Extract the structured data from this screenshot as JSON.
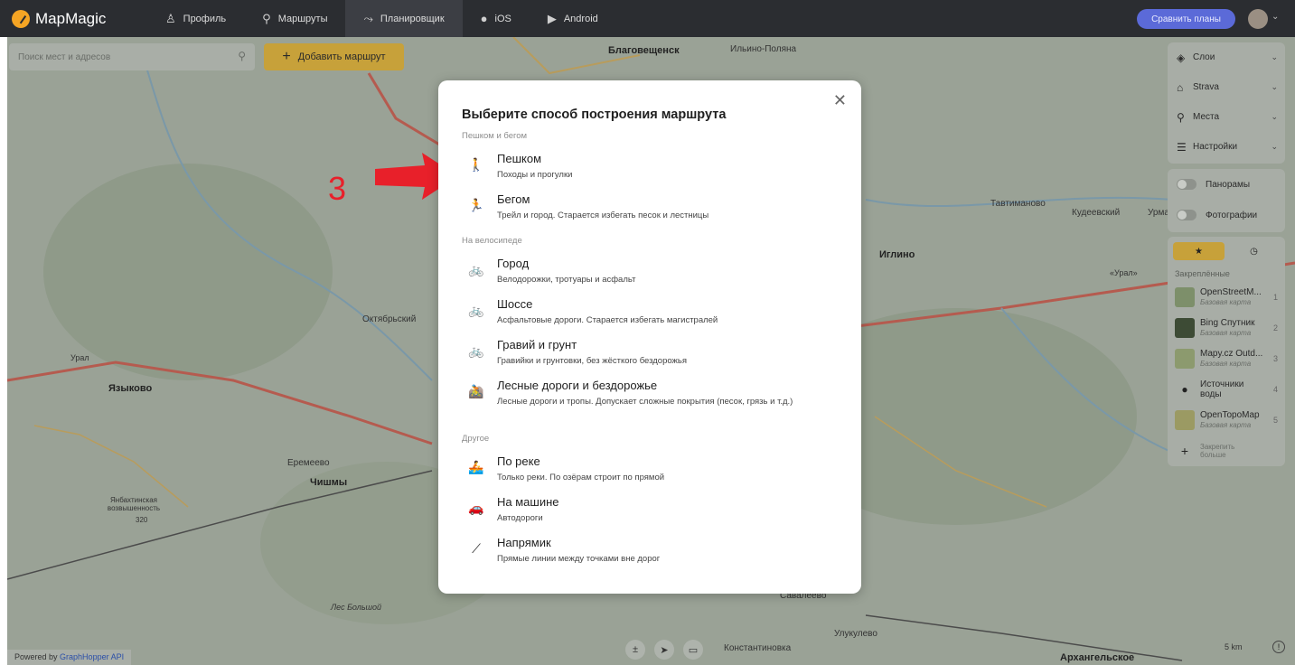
{
  "app": {
    "logo_text": "MapMagic",
    "nav": [
      {
        "label": "Профиль",
        "icon": "person-icon"
      },
      {
        "label": "Маршруты",
        "icon": "search-icon"
      },
      {
        "label": "Планировщик",
        "icon": "route-icon",
        "active": true
      },
      {
        "label": "iOS",
        "icon": "apple-icon"
      },
      {
        "label": "Android",
        "icon": "play-icon"
      }
    ],
    "compare_button": "Сравнить планы"
  },
  "map_toolbar": {
    "search_placeholder": "Поиск мест и адресов",
    "add_route": "Добавить маршрут"
  },
  "map_labels": {
    "blagoveshchensk": "Благовещенск",
    "ilyino_polyana": "Ильино-Поляна",
    "oktyabrsky": "Октябрьский",
    "yazykovo": "Языково",
    "eremeevo": "Еремеево",
    "chishmy": "Чишмы",
    "hill": "Янбахтинская возвышенность",
    "hill_height": "320",
    "forest": "Лес Большой",
    "iglino": "Иглино",
    "tavtimanovo": "Тавтиманово",
    "kudeevsky": "Кудеевский",
    "urman": "Урман",
    "ural1": "Урал",
    "ural2": "«Урал»",
    "savaleevo": "Савалеево",
    "ulkulevo": "Улукулево",
    "konstantinovka": "Константиновка",
    "arkhangelskoe": "Архангельское"
  },
  "layers_panel": {
    "items": [
      {
        "label": "Слои",
        "icon": "layers-icon"
      },
      {
        "label": "Strava",
        "icon": "strava-icon"
      },
      {
        "label": "Места",
        "icon": "places-icon"
      },
      {
        "label": "Настройки",
        "icon": "settings-icon"
      }
    ]
  },
  "toggles": [
    {
      "label": "Панорамы",
      "on": false
    },
    {
      "label": "Фотографии",
      "on": false
    }
  ],
  "basemaps": {
    "heading": "Закреплённые",
    "items": [
      {
        "name": "OpenStreetM...",
        "type": "Базовая карта",
        "num": "1",
        "color": "#7d8f6a"
      },
      {
        "name": "Bing Спутник",
        "type": "Базовая карта",
        "num": "2",
        "color": "#3d4b35"
      },
      {
        "name": "Mapy.cz Outd...",
        "type": "Базовая карта",
        "num": "3",
        "color": "#8c9a6e"
      },
      {
        "name": "Источники воды",
        "type": "",
        "num": "4",
        "color": "#a8ada6"
      },
      {
        "name": "OpenTopoMap",
        "type": "Базовая карта",
        "num": "5",
        "color": "#9b9a63"
      }
    ],
    "pin_more": "Закрепить больше"
  },
  "bottom": {
    "powered_prefix": "Powered by",
    "powered_link": "GraphHopper API",
    "scale": "5 km"
  },
  "annotation": {
    "number": "3"
  },
  "modal": {
    "title": "Выберите способ построения маршрута",
    "sections": [
      {
        "label": "Пешком и бегом",
        "options": [
          {
            "title": "Пешком",
            "desc": "Походы и прогулки",
            "icon": "hiking-icon",
            "glyph": "🚶"
          },
          {
            "title": "Бегом",
            "desc": "Трейл и город. Старается избегать песок и лестницы",
            "icon": "running-icon",
            "glyph": "🏃"
          }
        ]
      },
      {
        "label": "На велосипеде",
        "options": [
          {
            "title": "Город",
            "desc": "Велодорожки, тротуары и асфальт",
            "icon": "city-bike-icon",
            "glyph": "🚲"
          },
          {
            "title": "Шоссе",
            "desc": "Асфальтовые дороги. Старается избегать магистралей",
            "icon": "road-bike-icon",
            "glyph": "🚲"
          },
          {
            "title": "Гравий и грунт",
            "desc": "Гравийки и грунтовки, без жёсткого бездорожья",
            "icon": "gravel-bike-icon",
            "glyph": "🚲"
          },
          {
            "title": "Лесные дороги и бездорожье",
            "desc": "Лесные дороги и тропы. Допускает сложные покрытия (песок, грязь и т.д.)",
            "icon": "mtb-icon",
            "glyph": "🚵"
          }
        ]
      },
      {
        "label": "Другое",
        "options": [
          {
            "title": "По реке",
            "desc": "Только реки. По озёрам строит по прямой",
            "icon": "boat-icon",
            "glyph": "🚣"
          },
          {
            "title": "На машине",
            "desc": "Автодороги",
            "icon": "car-icon",
            "glyph": "🚗"
          },
          {
            "title": "Напрямик",
            "desc": "Прямые линии между точками вне дорог",
            "icon": "straight-line-icon",
            "glyph": "⟋"
          }
        ]
      }
    ]
  }
}
